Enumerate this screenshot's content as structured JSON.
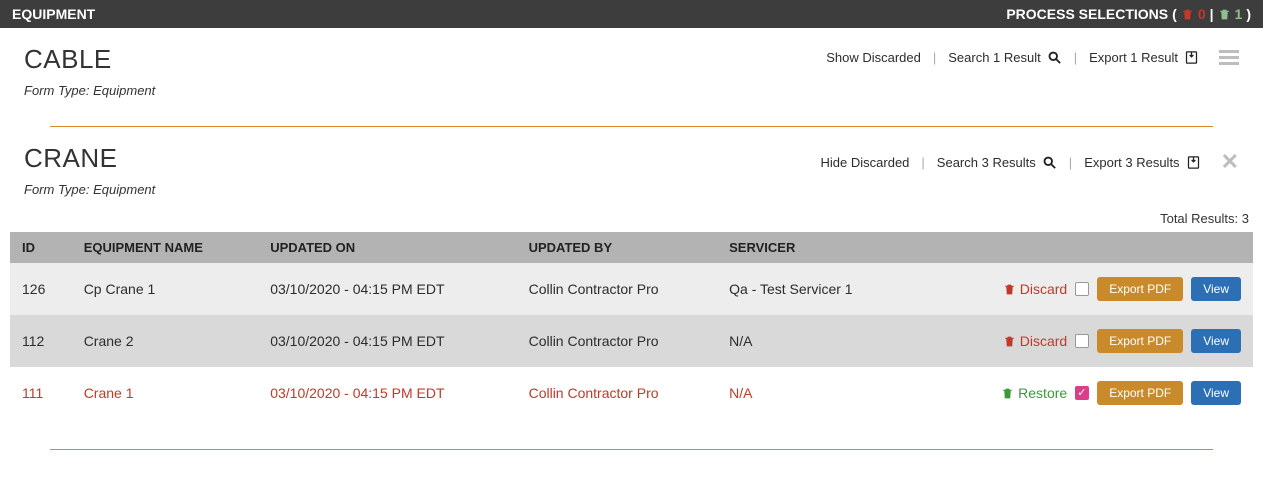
{
  "topbar": {
    "left": "EQUIPMENT",
    "process_label": "PROCESS SELECTIONS",
    "trash_count": "0",
    "restore_count": "1"
  },
  "sections": [
    {
      "title": "CABLE",
      "form_type_label": "Form Type:",
      "form_type_value": "Equipment",
      "discarded_toggle": "Show Discarded",
      "search_label": "Search 1 Result",
      "export_label": "Export 1 Result",
      "expanded": false
    },
    {
      "title": "CRANE",
      "form_type_label": "Form Type:",
      "form_type_value": "Equipment",
      "discarded_toggle": "Hide Discarded",
      "search_label": "Search 3 Results",
      "export_label": "Export 3 Results",
      "expanded": true
    }
  ],
  "total_results_label": "Total Results:",
  "total_results": "3",
  "table": {
    "headers": {
      "id": "ID",
      "name": "EQUIPMENT NAME",
      "updated_on": "UPDATED ON",
      "updated_by": "UPDATED BY",
      "servicer": "SERVICER"
    },
    "rows": [
      {
        "id": "126",
        "name": "Cp Crane 1",
        "updated_on": "03/10/2020 - 04:15 PM EDT",
        "updated_by": "Collin Contractor Pro",
        "servicer": "Qa - Test Servicer 1",
        "discarded": false,
        "checked": false
      },
      {
        "id": "112",
        "name": "Crane 2",
        "updated_on": "03/10/2020 - 04:15 PM EDT",
        "updated_by": "Collin Contractor Pro",
        "servicer": "N/A",
        "discarded": false,
        "checked": false
      },
      {
        "id": "111",
        "name": "Crane 1",
        "updated_on": "03/10/2020 - 04:15 PM EDT",
        "updated_by": "Collin Contractor Pro",
        "servicer": "N/A",
        "discarded": true,
        "checked": true
      }
    ]
  },
  "actions": {
    "discard": "Discard",
    "restore": "Restore",
    "export_pdf": "Export PDF",
    "view": "View"
  }
}
